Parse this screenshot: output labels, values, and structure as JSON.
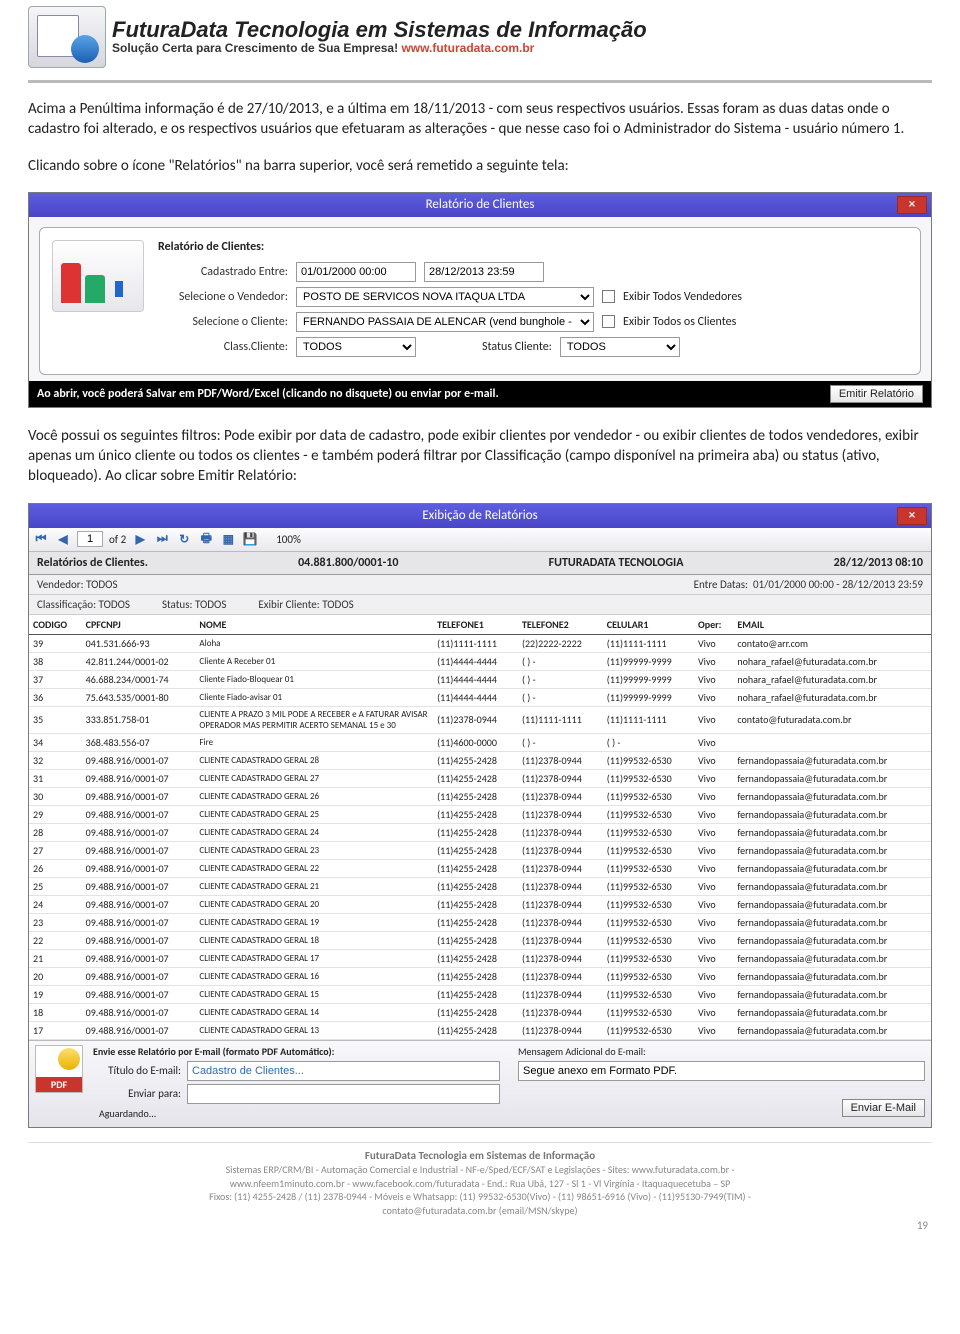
{
  "header": {
    "brand_line1": "FuturaData Tecnologia em Sistemas de Informação",
    "brand_line2_a": "Solução Certa para Crescimento de Sua Empresa! ",
    "brand_line2_url": "www.futuradata.com.br"
  },
  "para1": "Acima a Penúltima informação é de 27/10/2013, e a última em 18/11/2013 - com seus respectivos usuários. Essas foram as duas datas onde o cadastro foi alterado, e os respectivos usuários que efetuaram as alterações - que nesse caso foi o Administrador do Sistema - usuário número 1.",
  "para2": "Clicando sobre o ícone \"Relatórios\" na barra superior, você será remetido a seguinte tela:",
  "win1": {
    "title": "Relatório de Clientes",
    "form_title": "Relatório de Clientes:",
    "lbl_cadastrado": "Cadastrado Entre:",
    "date_from": "01/01/2000 00:00",
    "date_to": "28/12/2013 23:59",
    "lbl_vendedor": "Selecione o Vendedor:",
    "vendedor": "POSTO DE SERVICOS NOVA ITAQUA LTDA",
    "chk_vend": "Exibir Todos Vendedores",
    "lbl_cliente": "Selecione o Cliente:",
    "cliente": "FERNANDO PASSAIA DE ALENCAR (vend bunghole - p",
    "chk_cli": "Exibir Todos os Clientes",
    "lbl_class": "Class.Cliente:",
    "class_val": "TODOS",
    "lbl_status": "Status Cliente:",
    "status_val": "TODOS",
    "blackbar": "Ao abrir, você poderá Salvar em PDF/Word/Excel (clicando no disquete) ou enviar por e-mail.",
    "btn_emitir": "Emitir Relatório"
  },
  "para3": "Você possui os seguintes filtros: Pode exibir por data de cadastro, pode exibir clientes por vendedor - ou exibir clientes de todos vendedores, exibir apenas um único cliente ou todos os clientes - e também poderá filtrar por Classificação (campo disponível na primeira aba) ou status (ativo, bloqueado). Ao clicar sobre Emitir Relatório:",
  "viewer": {
    "title": "Exibição de Relatórios",
    "page_cur": "1",
    "page_of": "of 2",
    "zoom": "100%",
    "report_title": "Relatórios de Clientes.",
    "cnpj": "04.881.800/0001-10",
    "empresa": "FUTURADATA TECNOLOGIA",
    "data": "28/12/2013 08:10",
    "sub_vendedor_l": "Vendedor:",
    "sub_vendedor": "TODOS",
    "sub_entre_l": "Entre Datas:",
    "sub_entre": "01/01/2000 00:00 -   28/12/2013 23:59",
    "sub_class_l": "Classificação:",
    "sub_class": "TODOS",
    "sub_status_l": "Status:",
    "sub_status": "TODOS",
    "sub_exibir_l": "Exibir Cliente:",
    "sub_exibir": "TODOS",
    "cols": [
      "CODIGO",
      "CPFCNPJ",
      "NOME",
      "TELEFONE1",
      "TELEFONE2",
      "CELULAR1",
      "Oper:",
      "EMAIL"
    ],
    "rows": [
      [
        "39",
        "041.531.666-93",
        "Aloha",
        "(11)1111-1111",
        "(22)2222-2222",
        "(11)1111-1111",
        "Vivo",
        "contato@arr.com"
      ],
      [
        "38",
        "42.811.244/0001-02",
        "Cliente A Receber 01",
        "(11)4444-4444",
        "( ) -",
        "(11)99999-9999",
        "Vivo",
        "nohara_rafael@futuradata.com.br"
      ],
      [
        "37",
        "46.688.234/0001-74",
        "Cliente Fiado-Bloquear 01",
        "(11)4444-4444",
        "( ) -",
        "(11)99999-9999",
        "Vivo",
        "nohara_rafael@futuradata.com.br"
      ],
      [
        "36",
        "75.643.535/0001-80",
        "Cliente Fiado-avisar 01",
        "(11)4444-4444",
        "( ) -",
        "(11)99999-9999",
        "Vivo",
        "nohara_rafael@futuradata.com.br"
      ],
      [
        "35",
        "333.851.758-01",
        "CLIENTE A PRAZO 3 MIL PODE A RECEBER e A FATURAR AVISAR OPERADOR MAS PERMITIR ACERTO SEMANAL 15 e 30",
        "(11)2378-0944",
        "(11)1111-1111",
        "(11)1111-1111",
        "Vivo",
        "contato@futuradata.com.br"
      ],
      [
        "34",
        "368.483.556-07",
        "Fire",
        "(11)4600-0000",
        "( ) -",
        "( ) -",
        "Vivo",
        ""
      ],
      [
        "32",
        "09.488.916/0001-07",
        "CLIENTE CADASTRADO GERAL 28",
        "(11)4255-2428",
        "(11)2378-0944",
        "(11)99532-6530",
        "Vivo",
        "fernandopassaia@futuradata.com.br"
      ],
      [
        "31",
        "09.488.916/0001-07",
        "CLIENTE CADASTRADO GERAL 27",
        "(11)4255-2428",
        "(11)2378-0944",
        "(11)99532-6530",
        "Vivo",
        "fernandopassaia@futuradata.com.br"
      ],
      [
        "30",
        "09.488.916/0001-07",
        "CLIENTE CADASTRADO GERAL 26",
        "(11)4255-2428",
        "(11)2378-0944",
        "(11)99532-6530",
        "Vivo",
        "fernandopassaia@futuradata.com.br"
      ],
      [
        "29",
        "09.488.916/0001-07",
        "CLIENTE CADASTRADO GERAL 25",
        "(11)4255-2428",
        "(11)2378-0944",
        "(11)99532-6530",
        "Vivo",
        "fernandopassaia@futuradata.com.br"
      ],
      [
        "28",
        "09.488.916/0001-07",
        "CLIENTE CADASTRADO GERAL 24",
        "(11)4255-2428",
        "(11)2378-0944",
        "(11)99532-6530",
        "Vivo",
        "fernandopassaia@futuradata.com.br"
      ],
      [
        "27",
        "09.488.916/0001-07",
        "CLIENTE CADASTRADO GERAL 23",
        "(11)4255-2428",
        "(11)2378-0944",
        "(11)99532-6530",
        "Vivo",
        "fernandopassaia@futuradata.com.br"
      ],
      [
        "26",
        "09.488.916/0001-07",
        "CLIENTE CADASTRADO GERAL 22",
        "(11)4255-2428",
        "(11)2378-0944",
        "(11)99532-6530",
        "Vivo",
        "fernandopassaia@futuradata.com.br"
      ],
      [
        "25",
        "09.488.916/0001-07",
        "CLIENTE CADASTRADO GERAL 21",
        "(11)4255-2428",
        "(11)2378-0944",
        "(11)99532-6530",
        "Vivo",
        "fernandopassaia@futuradata.com.br"
      ],
      [
        "24",
        "09.488.916/0001-07",
        "CLIENTE CADASTRADO GERAL 20",
        "(11)4255-2428",
        "(11)2378-0944",
        "(11)99532-6530",
        "Vivo",
        "fernandopassaia@futuradata.com.br"
      ],
      [
        "23",
        "09.488.916/0001-07",
        "CLIENTE CADASTRADO GERAL 19",
        "(11)4255-2428",
        "(11)2378-0944",
        "(11)99532-6530",
        "Vivo",
        "fernandopassaia@futuradata.com.br"
      ],
      [
        "22",
        "09.488.916/0001-07",
        "CLIENTE CADASTRADO GERAL 18",
        "(11)4255-2428",
        "(11)2378-0944",
        "(11)99532-6530",
        "Vivo",
        "fernandopassaia@futuradata.com.br"
      ],
      [
        "21",
        "09.488.916/0001-07",
        "CLIENTE CADASTRADO GERAL 17",
        "(11)4255-2428",
        "(11)2378-0944",
        "(11)99532-6530",
        "Vivo",
        "fernandopassaia@futuradata.com.br"
      ],
      [
        "20",
        "09.488.916/0001-07",
        "CLIENTE CADASTRADO GERAL 16",
        "(11)4255-2428",
        "(11)2378-0944",
        "(11)99532-6530",
        "Vivo",
        "fernandopassaia@futuradata.com.br"
      ],
      [
        "19",
        "09.488.916/0001-07",
        "CLIENTE CADASTRADO GERAL 15",
        "(11)4255-2428",
        "(11)2378-0944",
        "(11)99532-6530",
        "Vivo",
        "fernandopassaia@futuradata.com.br"
      ],
      [
        "18",
        "09.488.916/0001-07",
        "CLIENTE CADASTRADO GERAL 14",
        "(11)4255-2428",
        "(11)2378-0944",
        "(11)99532-6530",
        "Vivo",
        "fernandopassaia@futuradata.com.br"
      ],
      [
        "17",
        "09.488.916/0001-07",
        "CLIENTE CADASTRADO GERAL 13",
        "(11)4255-2428",
        "(11)2378-0944",
        "(11)99532-6530",
        "Vivo",
        "fernandopassaia@futuradata.com.br"
      ]
    ],
    "email_header": "Envie esse Relatório por E-mail (formato PDF Automático):",
    "email_msg_l": "Mensagem Adicional do E-mail:",
    "email_msg": "Segue anexo em Formato PDF.",
    "email_titulo_l": "Título do E-mail:",
    "email_titulo": "Cadastro de Clientes...",
    "email_enviar_l": "Enviar para:",
    "email_status": "Aguardando...",
    "btn_enviar": "Enviar E-Mail",
    "pdf_label": "PDF"
  },
  "footer": {
    "l1": "FuturaData Tecnologia em Sistemas de Informação",
    "l2": "Sistemas ERP/CRM/BI - Automação Comercial e Industrial - NF-e/Sped/ECF/SAT e Legislações - Sites: www.futuradata.com.br -",
    "l3": "www.nfeem1minuto.com.br - www.facebook.com/futuradata - End.: Rua Ubá, 127 - Sl 1 - Vl Virgínia - Itaquaquecetuba – SP",
    "l4": "Fixos: (11) 4255-2428 / (11) 2378-0944 - Móveis e Whatsapp: (11) 99532-6530(Vivo) - (11) 98651-6916 (Vivo) - (11)95130-7949(TIM) -",
    "l5": "contato@futuradata.com.br (email/MSN/skype)",
    "page": "19"
  }
}
